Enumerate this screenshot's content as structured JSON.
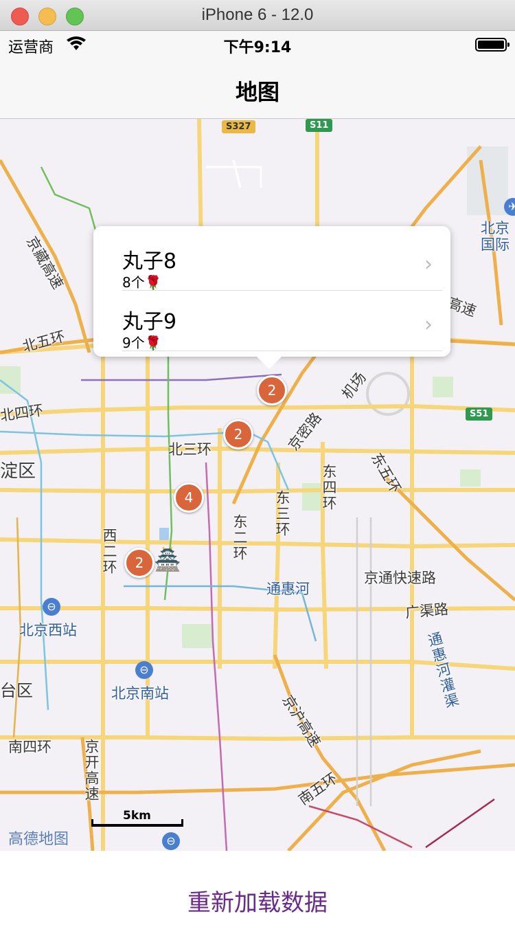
{
  "window": {
    "title": "iPhone 6 - 12.0"
  },
  "status_bar": {
    "carrier": "运营商",
    "time": "下午9:14"
  },
  "nav": {
    "title": "地图"
  },
  "callout": {
    "items": [
      {
        "title": "丸子8",
        "subtitle": "8个🌹"
      },
      {
        "title": "丸子9",
        "subtitle": "9个🌹"
      }
    ]
  },
  "clusters": [
    {
      "count": "2"
    },
    {
      "count": "2"
    },
    {
      "count": "4"
    },
    {
      "count": "2"
    }
  ],
  "map_labels": {
    "jingzang": "京藏高速",
    "beiwuhuan": "北五环",
    "beisihuan": "北四环",
    "haidian": "淀区",
    "beisanhuan": "北三环",
    "jingmi": "京密路",
    "jichang": "机场",
    "dongwuhuan": "东五环",
    "dongsihuan": "东四环",
    "dongsanhuan": "东三环",
    "dongerhuan": "东二环",
    "xierhuan": "西二环",
    "tonghuihe": "通惠河",
    "jingtong": "京通快速路",
    "guangqu": "广渠路",
    "tonghuihe_guanqu": "通惠河灌渠",
    "beijingxi": "北京西站",
    "beijingnan": "北京南站",
    "fengtai": "台区",
    "jinghu": "京沪高速",
    "nansihuan": "南四环",
    "jingkai": "京开高速",
    "nanwuhuan": "南五环",
    "beijing_airport": "北京国际",
    "gaosu": "高速",
    "s327": "S327",
    "s11": "S11",
    "s51": "S51"
  },
  "map_brand": "高德地图",
  "scale_text": "5km",
  "bottom": {
    "reload_label": "重新加载数据"
  },
  "colors": {
    "accent": "#6b2a8b",
    "cluster": "#d9653a",
    "road_major": "#f2c94c",
    "road_ring": "#e8a94a",
    "map_bg": "#f3f1f5"
  }
}
